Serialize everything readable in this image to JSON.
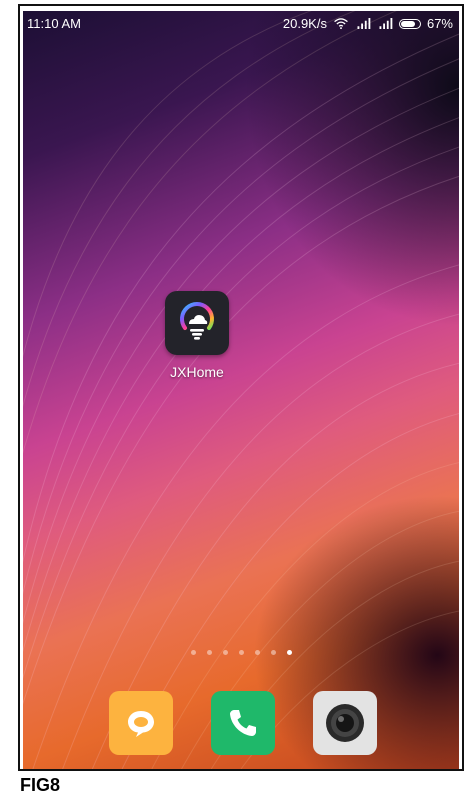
{
  "status_bar": {
    "time": "11:10 AM",
    "speed": "20.9K/s",
    "battery": "67%",
    "wifi_icon": "wifi-icon",
    "signal_icon": "signal-icon",
    "battery_icon": "battery-icon"
  },
  "home": {
    "apps": [
      {
        "label": "JXHome",
        "icon": "jxhome-bulb-icon"
      }
    ]
  },
  "pager": {
    "pages": 7,
    "active_page": 7
  },
  "dock": [
    {
      "name": "messaging",
      "icon": "chat-bubble-icon",
      "color": "#fdb33f"
    },
    {
      "name": "phone",
      "icon": "phone-icon",
      "color": "#1fb86a"
    },
    {
      "name": "camera",
      "icon": "camera-icon",
      "color": "#e3e3e3"
    }
  ],
  "caption": "FIG8"
}
